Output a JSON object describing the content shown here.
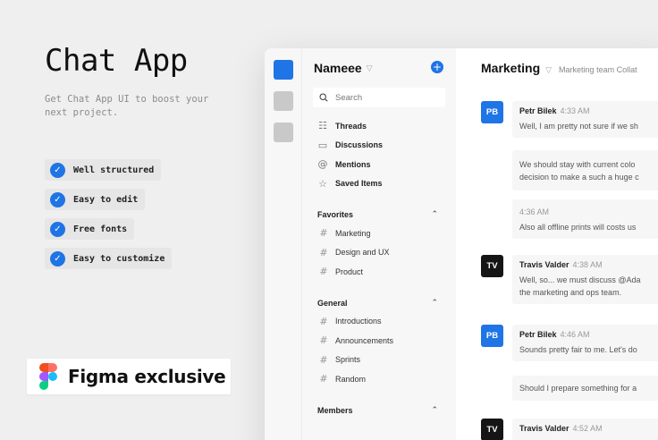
{
  "promo": {
    "title": "Chat App",
    "subtitle": "Get Chat App UI to boost your next project.",
    "features": [
      "Well structured",
      "Easy to edit",
      "Free fonts",
      "Easy to customize"
    ],
    "badge": "Figma exclusive"
  },
  "colors": {
    "accent": "#1f74e6",
    "dark_avatar": "#151515"
  },
  "workspace": {
    "name": "Nameee",
    "add_icon": "+"
  },
  "search": {
    "placeholder": "Search"
  },
  "nav": [
    {
      "label": "Threads",
      "icon": "threads-icon"
    },
    {
      "label": "Discussions",
      "icon": "discussions-icon"
    },
    {
      "label": "Mentions",
      "icon": "at-icon"
    },
    {
      "label": "Saved Items",
      "icon": "star-icon"
    }
  ],
  "favorites": {
    "title": "Favorites",
    "channels": [
      "Marketing",
      "Design and UX",
      "Product"
    ]
  },
  "general": {
    "title": "General",
    "channels": [
      "Introductions",
      "Announcements",
      "Sprints",
      "Random"
    ]
  },
  "members": {
    "title": "Members"
  },
  "channel": {
    "name": "Marketing",
    "description": "Marketing team Collat"
  },
  "messages": [
    {
      "initials": "PB",
      "author": "Petr Bilek",
      "time": "4:33 AM",
      "lines": [
        "Well, I am pretty not sure if we sh"
      ]
    },
    {
      "lines": [
        "We should stay with current colo",
        "decision to make a such a huge c"
      ]
    },
    {
      "time": "4:36 AM",
      "lines": [
        "Also all offline prints will costs us"
      ]
    },
    {
      "initials": "TV",
      "author": "Travis Valder",
      "time": "4:38 AM",
      "lines": [
        "Well, so... we must discuss @Ada",
        "the marketing and ops team."
      ]
    },
    {
      "initials": "PB",
      "author": "Petr Bilek",
      "time": "4:46 AM",
      "lines": [
        "Sounds pretty fair to me. Let's do"
      ]
    },
    {
      "lines": [
        "Should I prepare something for a"
      ]
    },
    {
      "initials": "TV",
      "author": "Travis Valder",
      "time": "4:52 AM",
      "lines": []
    }
  ]
}
